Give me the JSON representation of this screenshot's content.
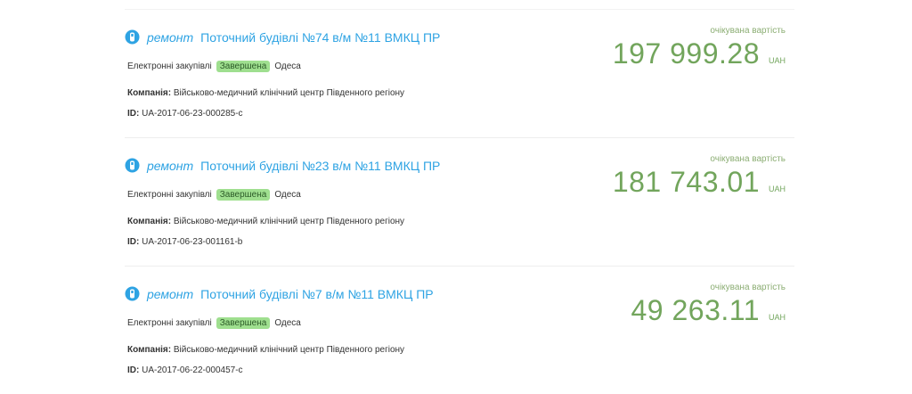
{
  "accent": "#2ea3e3",
  "price_color": "#72a55c",
  "badge_color": "#9fdf8f",
  "icon": "tool-icon",
  "tenders": [
    {
      "kind": "ремонт",
      "title": "Поточний будівлі №74 в/м №11 ВМКЦ ПР",
      "procurement": "Електронні закупівлі",
      "status": "Завершена",
      "city": "Одеса",
      "company_label": "Компанія:",
      "company": "Військово-медичний клінічний центр Південного регіону",
      "id_label": "ID:",
      "id": "UA-2017-06-23-000285-c",
      "expected_label": "очікувана вартість",
      "amount": "197 999.28",
      "currency": "UAH"
    },
    {
      "kind": "ремонт",
      "title": "Поточний будівлі №23 в/м №11 ВМКЦ ПР",
      "procurement": "Електронні закупівлі",
      "status": "Завершена",
      "city": "Одеса",
      "company_label": "Компанія:",
      "company": "Військово-медичний клінічний центр Південного регіону",
      "id_label": "ID:",
      "id": "UA-2017-06-23-001161-b",
      "expected_label": "очікувана вартість",
      "amount": "181 743.01",
      "currency": "UAH"
    },
    {
      "kind": "ремонт",
      "title": "Поточний будівлі №7 в/м №11 ВМКЦ ПР",
      "procurement": "Електронні закупівлі",
      "status": "Завершена",
      "city": "Одеса",
      "company_label": "Компанія:",
      "company": "Військово-медичний клінічний центр Південного регіону",
      "id_label": "ID:",
      "id": "UA-2017-06-22-000457-c",
      "expected_label": "очікувана вартість",
      "amount": "49 263.11",
      "currency": "UAH"
    }
  ]
}
